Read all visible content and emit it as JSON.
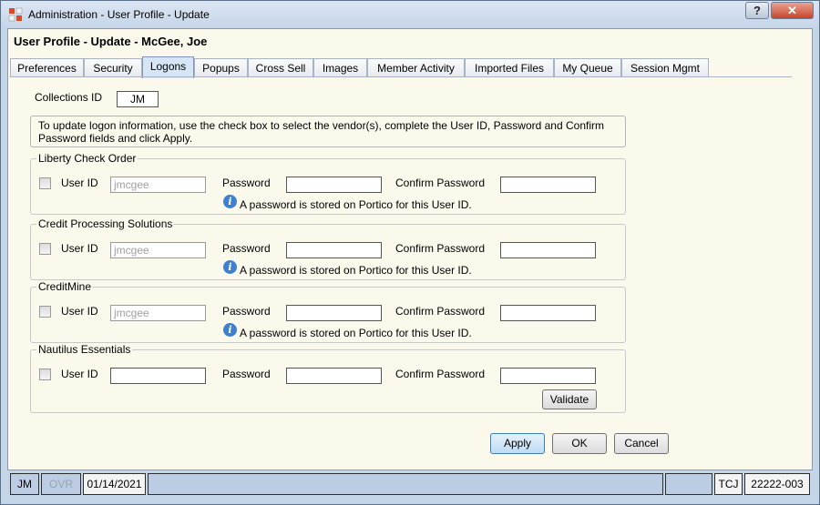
{
  "window": {
    "title": "Administration - User Profile - Update",
    "help_label": "?",
    "close_label": "✕"
  },
  "profile_title": "User Profile - Update - McGee, Joe",
  "tabs": [
    "Preferences",
    "Security",
    "Logons",
    "Popups",
    "Cross Sell",
    "Images",
    "Member Activity",
    "Imported Files",
    "My Queue",
    "Session Mgmt"
  ],
  "active_tab": "Logons",
  "collections": {
    "label": "Collections ID",
    "value": "JM"
  },
  "instructions": "To update logon information, use the check box to select the vendor(s), complete the User ID, Password and Confirm Password fields and click Apply.",
  "field_labels": {
    "user_id": "User ID",
    "password": "Password",
    "confirm_password": "Confirm Password"
  },
  "vendors": [
    {
      "name": "Liberty Check Order",
      "user_id": "jmcgee",
      "password_note": "A password is stored on Portico for this User ID."
    },
    {
      "name": "Credit Processing Solutions",
      "user_id": "jmcgee",
      "password_note": "A password is stored on Portico for this User ID."
    },
    {
      "name": "CreditMine",
      "user_id": "jmcgee",
      "password_note": "A password is stored on Portico for this User ID."
    },
    {
      "name": "Nautilus Essentials",
      "user_id": "",
      "validate_label": "Validate"
    }
  ],
  "buttons": {
    "apply": "Apply",
    "ok": "OK",
    "cancel": "Cancel"
  },
  "status_bar": {
    "user": "JM",
    "ovr": "OVR",
    "date": "01/14/2021",
    "code": "TCJ",
    "id": "22222-003"
  },
  "icons": {
    "app": "admin-grid-icon",
    "info": "info-icon"
  }
}
